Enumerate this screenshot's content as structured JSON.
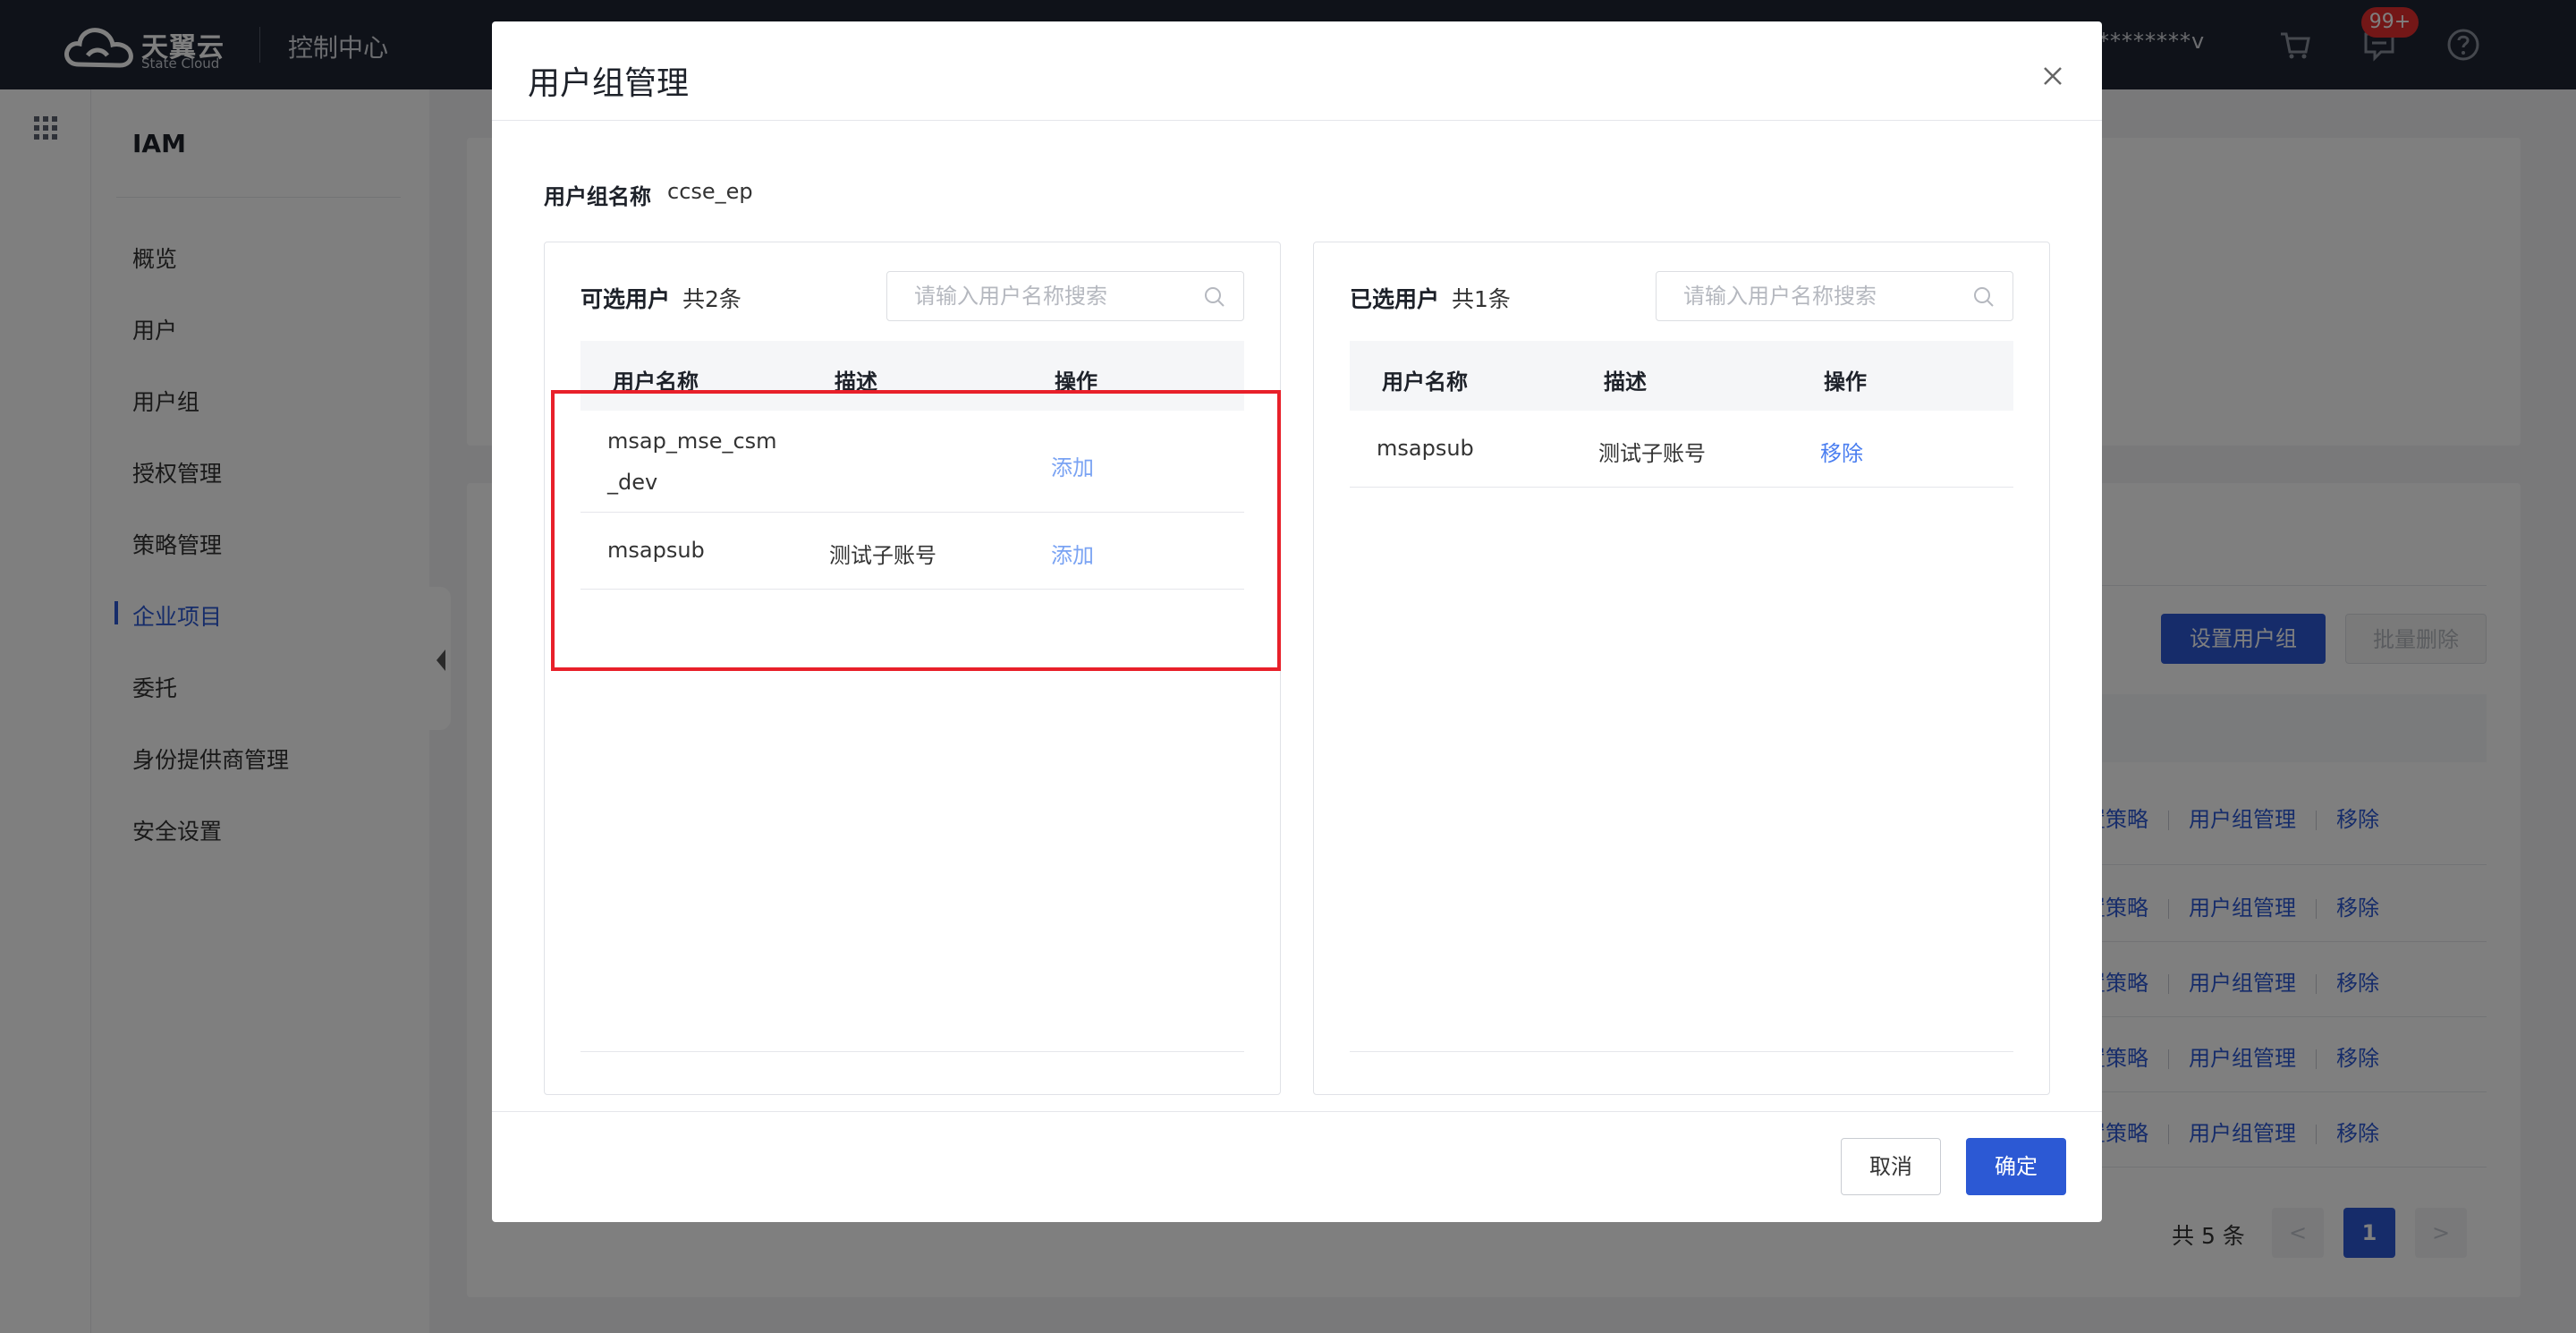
{
  "topbar": {
    "brand_cn": "天翼云",
    "brand_en": "State Cloud",
    "console_title": "控制中心",
    "user": "********v",
    "badge": "99+"
  },
  "sidebar": {
    "title": "IAM",
    "items": [
      {
        "label": "概览"
      },
      {
        "label": "用户"
      },
      {
        "label": "用户组"
      },
      {
        "label": "授权管理"
      },
      {
        "label": "策略管理"
      },
      {
        "label": "企业项目",
        "active": true
      },
      {
        "label": "委托"
      },
      {
        "label": "身份提供商管理"
      },
      {
        "label": "安全设置"
      }
    ]
  },
  "background": {
    "set_group_button": "设置用户组",
    "batch_delete_button": "批量删除",
    "row_actions": [
      {
        "policy": "置策略",
        "manage": "用户组管理",
        "remove": "移除"
      },
      {
        "policy": "置策略",
        "manage": "用户组管理",
        "remove": "移除"
      },
      {
        "policy": "置策略",
        "manage": "用户组管理",
        "remove": "移除"
      },
      {
        "policy": "置策略",
        "manage": "用户组管理",
        "remove": "移除"
      },
      {
        "policy": "置策略",
        "manage": "用户组管理",
        "remove": "移除"
      }
    ],
    "pager": {
      "total": "共 5 条",
      "prev": "<",
      "current": "1",
      "next": ">"
    }
  },
  "modal": {
    "title": "用户组管理",
    "group_label": "用户组名称",
    "group_value": "ccse_ep",
    "available": {
      "title": "可选用户",
      "count": "共2条",
      "search_placeholder": "请输入用户名称搜索",
      "columns": [
        "用户名称",
        "描述",
        "操作"
      ],
      "rows": [
        {
          "name_line1": "msap_mse_csm",
          "name_line2": "_dev",
          "desc": "",
          "action": "添加"
        },
        {
          "name_line1": "msapsub",
          "name_line2": "",
          "desc": "测试子账号",
          "action": "添加"
        }
      ]
    },
    "selected": {
      "title": "已选用户",
      "count": "共1条",
      "search_placeholder": "请输入用户名称搜索",
      "columns": [
        "用户名称",
        "描述",
        "操作"
      ],
      "rows": [
        {
          "name": "msapsub",
          "desc": "测试子账号",
          "action": "移除"
        }
      ]
    },
    "cancel_label": "取消",
    "ok_label": "确定"
  },
  "colors": {
    "primary": "#2c59d4",
    "link": "#4a7ef0",
    "topbar": "#1f2532",
    "highlight": "#e8202a"
  }
}
